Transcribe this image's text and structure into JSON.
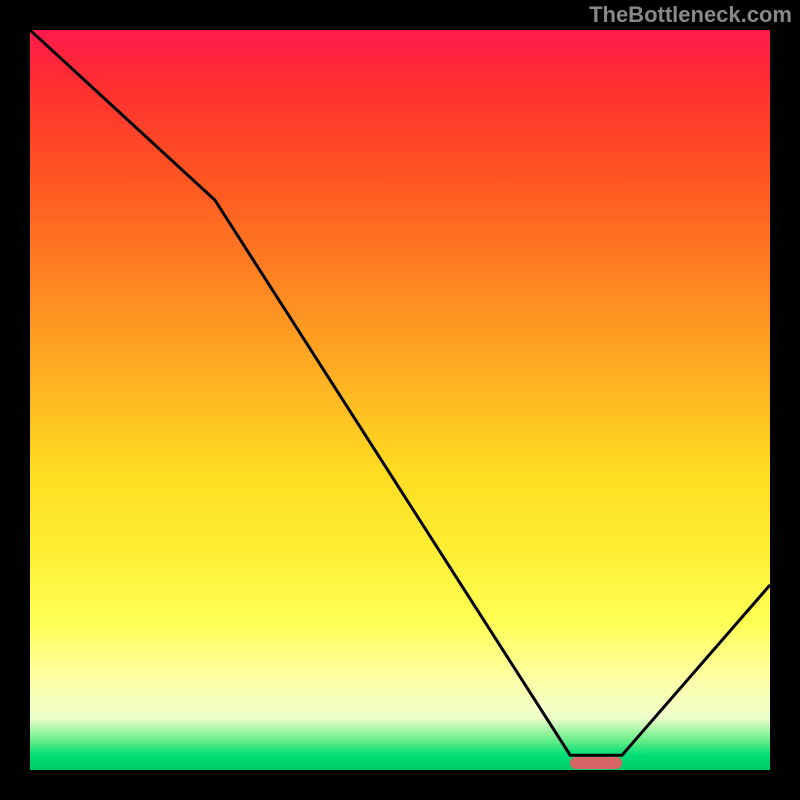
{
  "watermark": "TheBottleneck.com",
  "chart_data": {
    "type": "line",
    "title": "",
    "xlabel": "",
    "ylabel": "",
    "xlim": [
      0,
      100
    ],
    "ylim": [
      0,
      100
    ],
    "background": "gradient-green-to-red",
    "series": [
      {
        "name": "bottleneck-curve",
        "x": [
          0,
          25,
          73,
          80,
          100
        ],
        "values": [
          100,
          77,
          2,
          2,
          25
        ],
        "color": "#000000"
      }
    ],
    "marker": {
      "name": "optimal-range",
      "x_start": 73,
      "x_end": 80,
      "y": 1,
      "color": "#d96666"
    },
    "gradient_description": "vertical gradient, red (high bottleneck) at top to green (no bottleneck) at bottom"
  }
}
